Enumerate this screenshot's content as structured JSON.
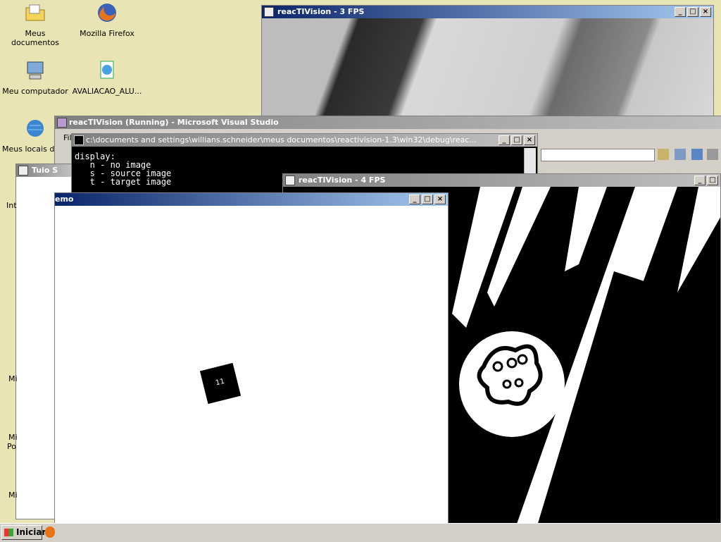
{
  "desktop": {
    "icons": [
      {
        "label": "Meus documentos"
      },
      {
        "label": "Mozilla Firefox"
      },
      {
        "label": "Meu computador"
      },
      {
        "label": "AVALIACAO_ALU..."
      },
      {
        "label": "Meus locais de r"
      }
    ],
    "side_fragments": [
      "Int",
      "Mi",
      "Mi",
      "Po",
      "Mi"
    ]
  },
  "window_camera_top": {
    "title": "reacTIVision - 3 FPS"
  },
  "window_vs": {
    "title": "reacTIVision (Running) - Microsoft Visual Studio",
    "menu_fragment": "Fil"
  },
  "window_console": {
    "title": "c:\\documents and settings\\willians.schneider\\meus documentos\\reactivision-1.3\\win32\\debug\\reac...",
    "text": "display:\n   n - no image\n   s - source image\n   t - target image"
  },
  "window_tuio": {
    "title_fragment": "Tuio S"
  },
  "window_demo": {
    "title_fragment": "emo",
    "marker_id": "11"
  },
  "window_camera_threshold": {
    "title": "reacTIVision - 4 FPS"
  },
  "taskbar": {
    "start_label": "Iniciar"
  }
}
